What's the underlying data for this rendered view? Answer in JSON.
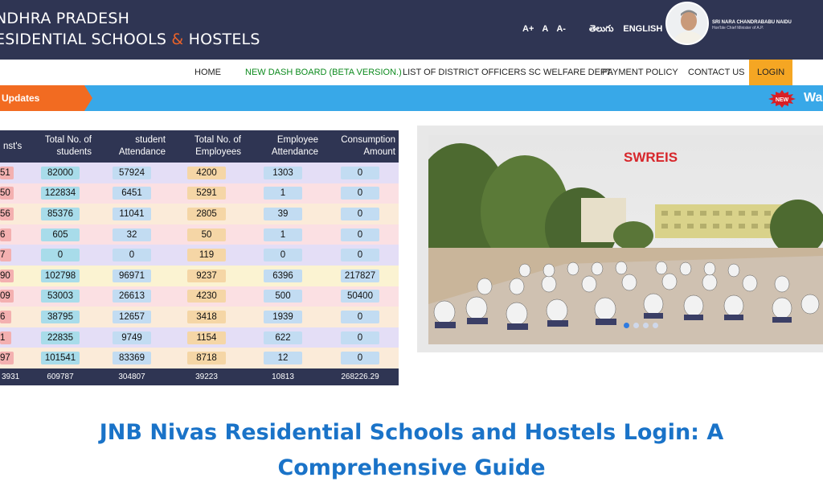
{
  "header": {
    "title_line1": "NDHRA PRADESH",
    "title_line2_a": "ESIDENTIAL SCHOOLS ",
    "title_amp": "&",
    "title_line2_b": " HOSTELS",
    "font_controls": [
      "A+",
      "A",
      "A-"
    ],
    "languages": [
      "తెలుగు",
      "ENGLISH"
    ],
    "cm_name": "SRI NARA CHANDRABABU NAIDU",
    "cm_title": "Hon'ble Chief Minister of A.P."
  },
  "nav": {
    "items": [
      "HOME",
      "NEW DASH BOARD (BETA VERSION.)",
      "LIST OF DISTRICT OFFICERS SC WELFARE DEPT.",
      "PAYMENT POLICY",
      "CONTACT US",
      "LOGIN"
    ]
  },
  "updates": {
    "label": "Updates",
    "badge": "NEW",
    "marquee": "Wa"
  },
  "table": {
    "headers": [
      "nst's",
      "Total No. of students",
      "student Attendance",
      "Total No. of Employees",
      "Employee Attendance",
      "Consumption Amount"
    ],
    "rows": [
      [
        "51",
        "82000",
        "57924",
        "4200",
        "1303",
        "0"
      ],
      [
        "50",
        "122834",
        "6451",
        "5291",
        "1",
        "0"
      ],
      [
        "56",
        "85376",
        "11041",
        "2805",
        "39",
        "0"
      ],
      [
        "6",
        "605",
        "32",
        "50",
        "1",
        "0"
      ],
      [
        "7",
        "0",
        "0",
        "119",
        "0",
        "0"
      ],
      [
        "90",
        "102798",
        "96971",
        "9237",
        "6396",
        "217827"
      ],
      [
        "09",
        "53003",
        "26613",
        "4230",
        "500",
        "50400"
      ],
      [
        "6",
        "38795",
        "12657",
        "3418",
        "1939",
        "0"
      ],
      [
        "1",
        "22835",
        "9749",
        "1154",
        "622",
        "0"
      ],
      [
        "97",
        "101541",
        "83369",
        "8718",
        "12",
        "0"
      ]
    ],
    "totals": [
      "3931",
      "609787",
      "304807",
      "39223",
      "10813",
      "268226.29"
    ],
    "row_colors": [
      "#e4def6",
      "#fbe0e3",
      "#fbebd9",
      "#fbe0e3",
      "#e4def6",
      "#fbf3d2",
      "#fbe0e3",
      "#fbebd9",
      "#e4def6",
      "#fbebd9"
    ],
    "cell_colors": {
      "students": "#a8dcea",
      "employees": "#f5d6a6",
      "other": "#c2dcf2",
      "first": "#f3b0b0"
    }
  },
  "slider": {
    "caption": "SWREIS",
    "slide_count": 4,
    "active_slide": 1
  },
  "article": {
    "title_line1": "JNB Nivas Residential Schools and Hostels Login: A",
    "title_line2": "Comprehensive Guide"
  }
}
